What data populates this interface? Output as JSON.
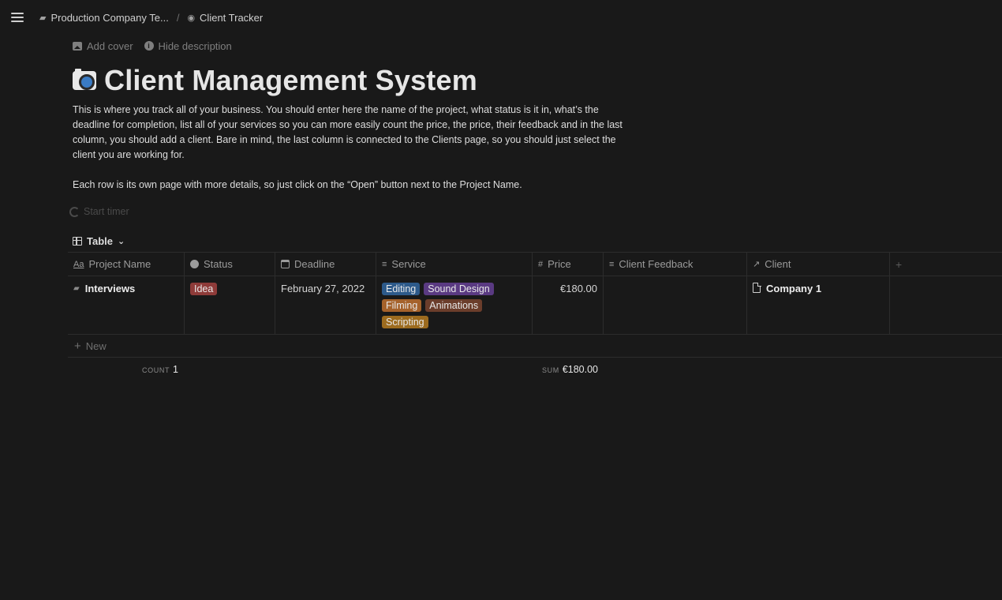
{
  "topbar": {
    "crumbs": [
      {
        "label": "Production Company Te...",
        "icon": "workspace-icon"
      },
      {
        "label": "Client Tracker",
        "icon": "camera-icon"
      }
    ],
    "separator": "/"
  },
  "page": {
    "actions": {
      "add_cover": "Add cover",
      "hide_description": "Hide description"
    },
    "title": "Client Management System",
    "description": [
      "This is where you track all of your business. You should enter here the name of the project, what status is it in, what’s the deadline for completion, list all of your services so you can more easily count the price, the price, their feedback and in the last column, you should add a client. Bare in mind, the last column is connected to the Clients page, so you should just select the client you are working for.",
      "Each row is its own page with more details, so just click on the “Open” button next to the Project Name."
    ],
    "timer_label": "Start timer",
    "view_label": "Table",
    "view_chevron": "⌄"
  },
  "table": {
    "columns": [
      {
        "label": "Project Name",
        "icon": "Aa"
      },
      {
        "label": "Status",
        "icon": "status-icon"
      },
      {
        "label": "Deadline",
        "icon": "calendar-icon"
      },
      {
        "label": "Service",
        "icon": "≡"
      },
      {
        "label": "Price",
        "icon": "#"
      },
      {
        "label": "Client Feedback",
        "icon": "≡"
      },
      {
        "label": "Client",
        "icon": "↗"
      }
    ],
    "add_column": "+",
    "rows": [
      {
        "name": "Interviews",
        "status": {
          "label": "Idea",
          "color": "#8e3b39"
        },
        "deadline": "February 27, 2022",
        "services": [
          {
            "label": "Editing",
            "color": "#2d5a8a"
          },
          {
            "label": "Sound Design",
            "color": "#5a3a82"
          },
          {
            "label": "Filming",
            "color": "#a5622b"
          },
          {
            "label": "Animations",
            "color": "#6b3d2b"
          },
          {
            "label": "Scripting",
            "color": "#9c6b1f"
          }
        ],
        "price": "€180.00",
        "feedback": "",
        "client": "Company 1"
      }
    ],
    "new_label": "New",
    "count_label": "COUNT",
    "count_value": "1",
    "sum_label": "SUM",
    "sum_value": "€180.00"
  }
}
